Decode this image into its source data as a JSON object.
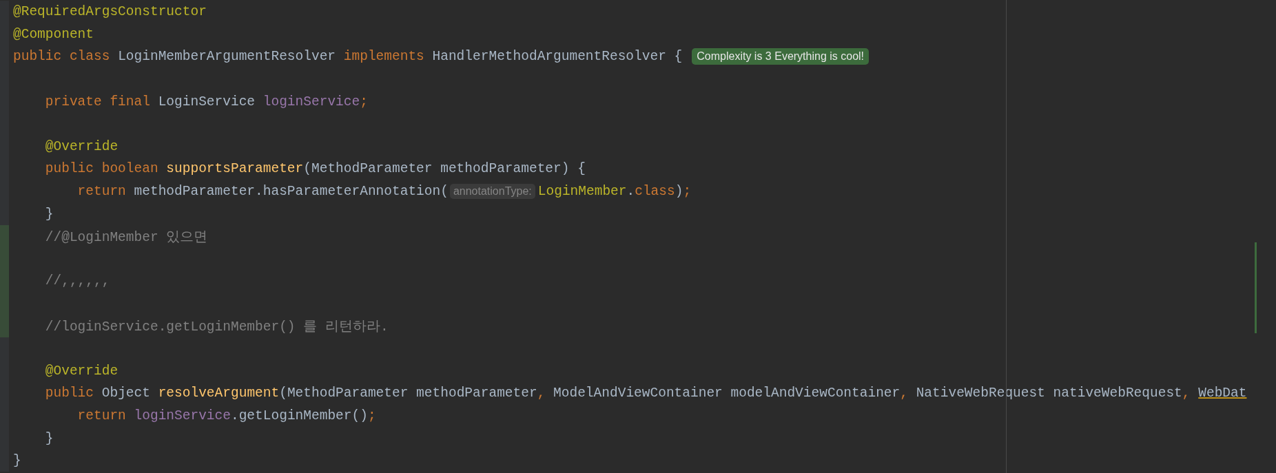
{
  "editor": {
    "lines": [
      {
        "kind": "code",
        "modified": false,
        "tokens": [
          {
            "kind": "annotation",
            "text": "@RequiredArgsConstructor"
          }
        ]
      },
      {
        "kind": "code",
        "modified": false,
        "tokens": [
          {
            "kind": "annotation",
            "text": "@Component"
          }
        ]
      },
      {
        "kind": "code",
        "modified": false,
        "tokens": [
          {
            "kind": "keyword",
            "text": "public class "
          },
          {
            "kind": "plain",
            "text": "LoginMemberArgumentResolver "
          },
          {
            "kind": "keyword",
            "text": "implements "
          },
          {
            "kind": "plain",
            "text": "HandlerMethodArgumentResolver {"
          },
          {
            "kind": "badge",
            "text": "Complexity is 3 Everything is cool!"
          }
        ]
      },
      {
        "kind": "blank",
        "modified": false
      },
      {
        "kind": "code",
        "modified": false,
        "tokens": [
          {
            "kind": "keyword",
            "text": "    private final "
          },
          {
            "kind": "plain",
            "text": "LoginService "
          },
          {
            "kind": "field",
            "text": "loginService"
          },
          {
            "kind": "keyword",
            "text": ";"
          }
        ]
      },
      {
        "kind": "blank",
        "modified": false
      },
      {
        "kind": "code",
        "modified": false,
        "tokens": [
          {
            "kind": "annotation",
            "text": "    @Override"
          }
        ]
      },
      {
        "kind": "code",
        "modified": false,
        "tokens": [
          {
            "kind": "keyword",
            "text": "    public boolean "
          },
          {
            "kind": "method",
            "text": "supportsParameter"
          },
          {
            "kind": "plain",
            "text": "(MethodParameter methodParameter) {"
          }
        ]
      },
      {
        "kind": "code",
        "modified": false,
        "tokens": [
          {
            "kind": "keyword",
            "text": "        return "
          },
          {
            "kind": "plain",
            "text": "methodParameter.hasParameterAnnotation("
          },
          {
            "kind": "hint",
            "text": "annotationType:"
          },
          {
            "kind": "annotation",
            "text": "LoginMember"
          },
          {
            "kind": "plain",
            "text": "."
          },
          {
            "kind": "keyword",
            "text": "class"
          },
          {
            "kind": "plain",
            "text": ")"
          },
          {
            "kind": "keyword",
            "text": ";"
          }
        ]
      },
      {
        "kind": "code",
        "modified": false,
        "tokens": [
          {
            "kind": "plain",
            "text": "    }"
          }
        ]
      },
      {
        "kind": "code",
        "modified": true,
        "tokens": [
          {
            "kind": "comment",
            "text": "    //@LoginMember 있으면"
          }
        ]
      },
      {
        "kind": "blank",
        "modified": true
      },
      {
        "kind": "code",
        "modified": true,
        "tokens": [
          {
            "kind": "comment",
            "text": "    //,,,,,,"
          }
        ]
      },
      {
        "kind": "blank",
        "modified": true
      },
      {
        "kind": "code",
        "modified": true,
        "tokens": [
          {
            "kind": "comment",
            "text": "    //loginService.getLoginMember() 를 리턴하라."
          }
        ]
      },
      {
        "kind": "blank",
        "modified": false
      },
      {
        "kind": "code",
        "modified": false,
        "tokens": [
          {
            "kind": "annotation",
            "text": "    @Override"
          }
        ]
      },
      {
        "kind": "code",
        "modified": false,
        "tokens": [
          {
            "kind": "keyword",
            "text": "    public "
          },
          {
            "kind": "plain",
            "text": "Object "
          },
          {
            "kind": "method",
            "text": "resolveArgument"
          },
          {
            "kind": "plain",
            "text": "(MethodParameter methodParameter"
          },
          {
            "kind": "keyword",
            "text": ", "
          },
          {
            "kind": "plain",
            "text": "ModelAndViewContainer modelAndViewContainer"
          },
          {
            "kind": "keyword",
            "text": ", "
          },
          {
            "kind": "plain",
            "text": "NativeWebRequest nativeWebRequest"
          },
          {
            "kind": "keyword",
            "text": ", "
          },
          {
            "kind": "warning",
            "text": "WebDat"
          }
        ]
      },
      {
        "kind": "code",
        "modified": false,
        "tokens": [
          {
            "kind": "keyword",
            "text": "        return "
          },
          {
            "kind": "field",
            "text": "loginService"
          },
          {
            "kind": "plain",
            "text": ".getLoginMember()"
          },
          {
            "kind": "keyword",
            "text": ";"
          }
        ]
      },
      {
        "kind": "code",
        "modified": false,
        "tokens": [
          {
            "kind": "plain",
            "text": "    }"
          }
        ]
      },
      {
        "kind": "code",
        "modified": false,
        "tokens": [
          {
            "kind": "plain",
            "text": "}"
          }
        ]
      }
    ]
  }
}
